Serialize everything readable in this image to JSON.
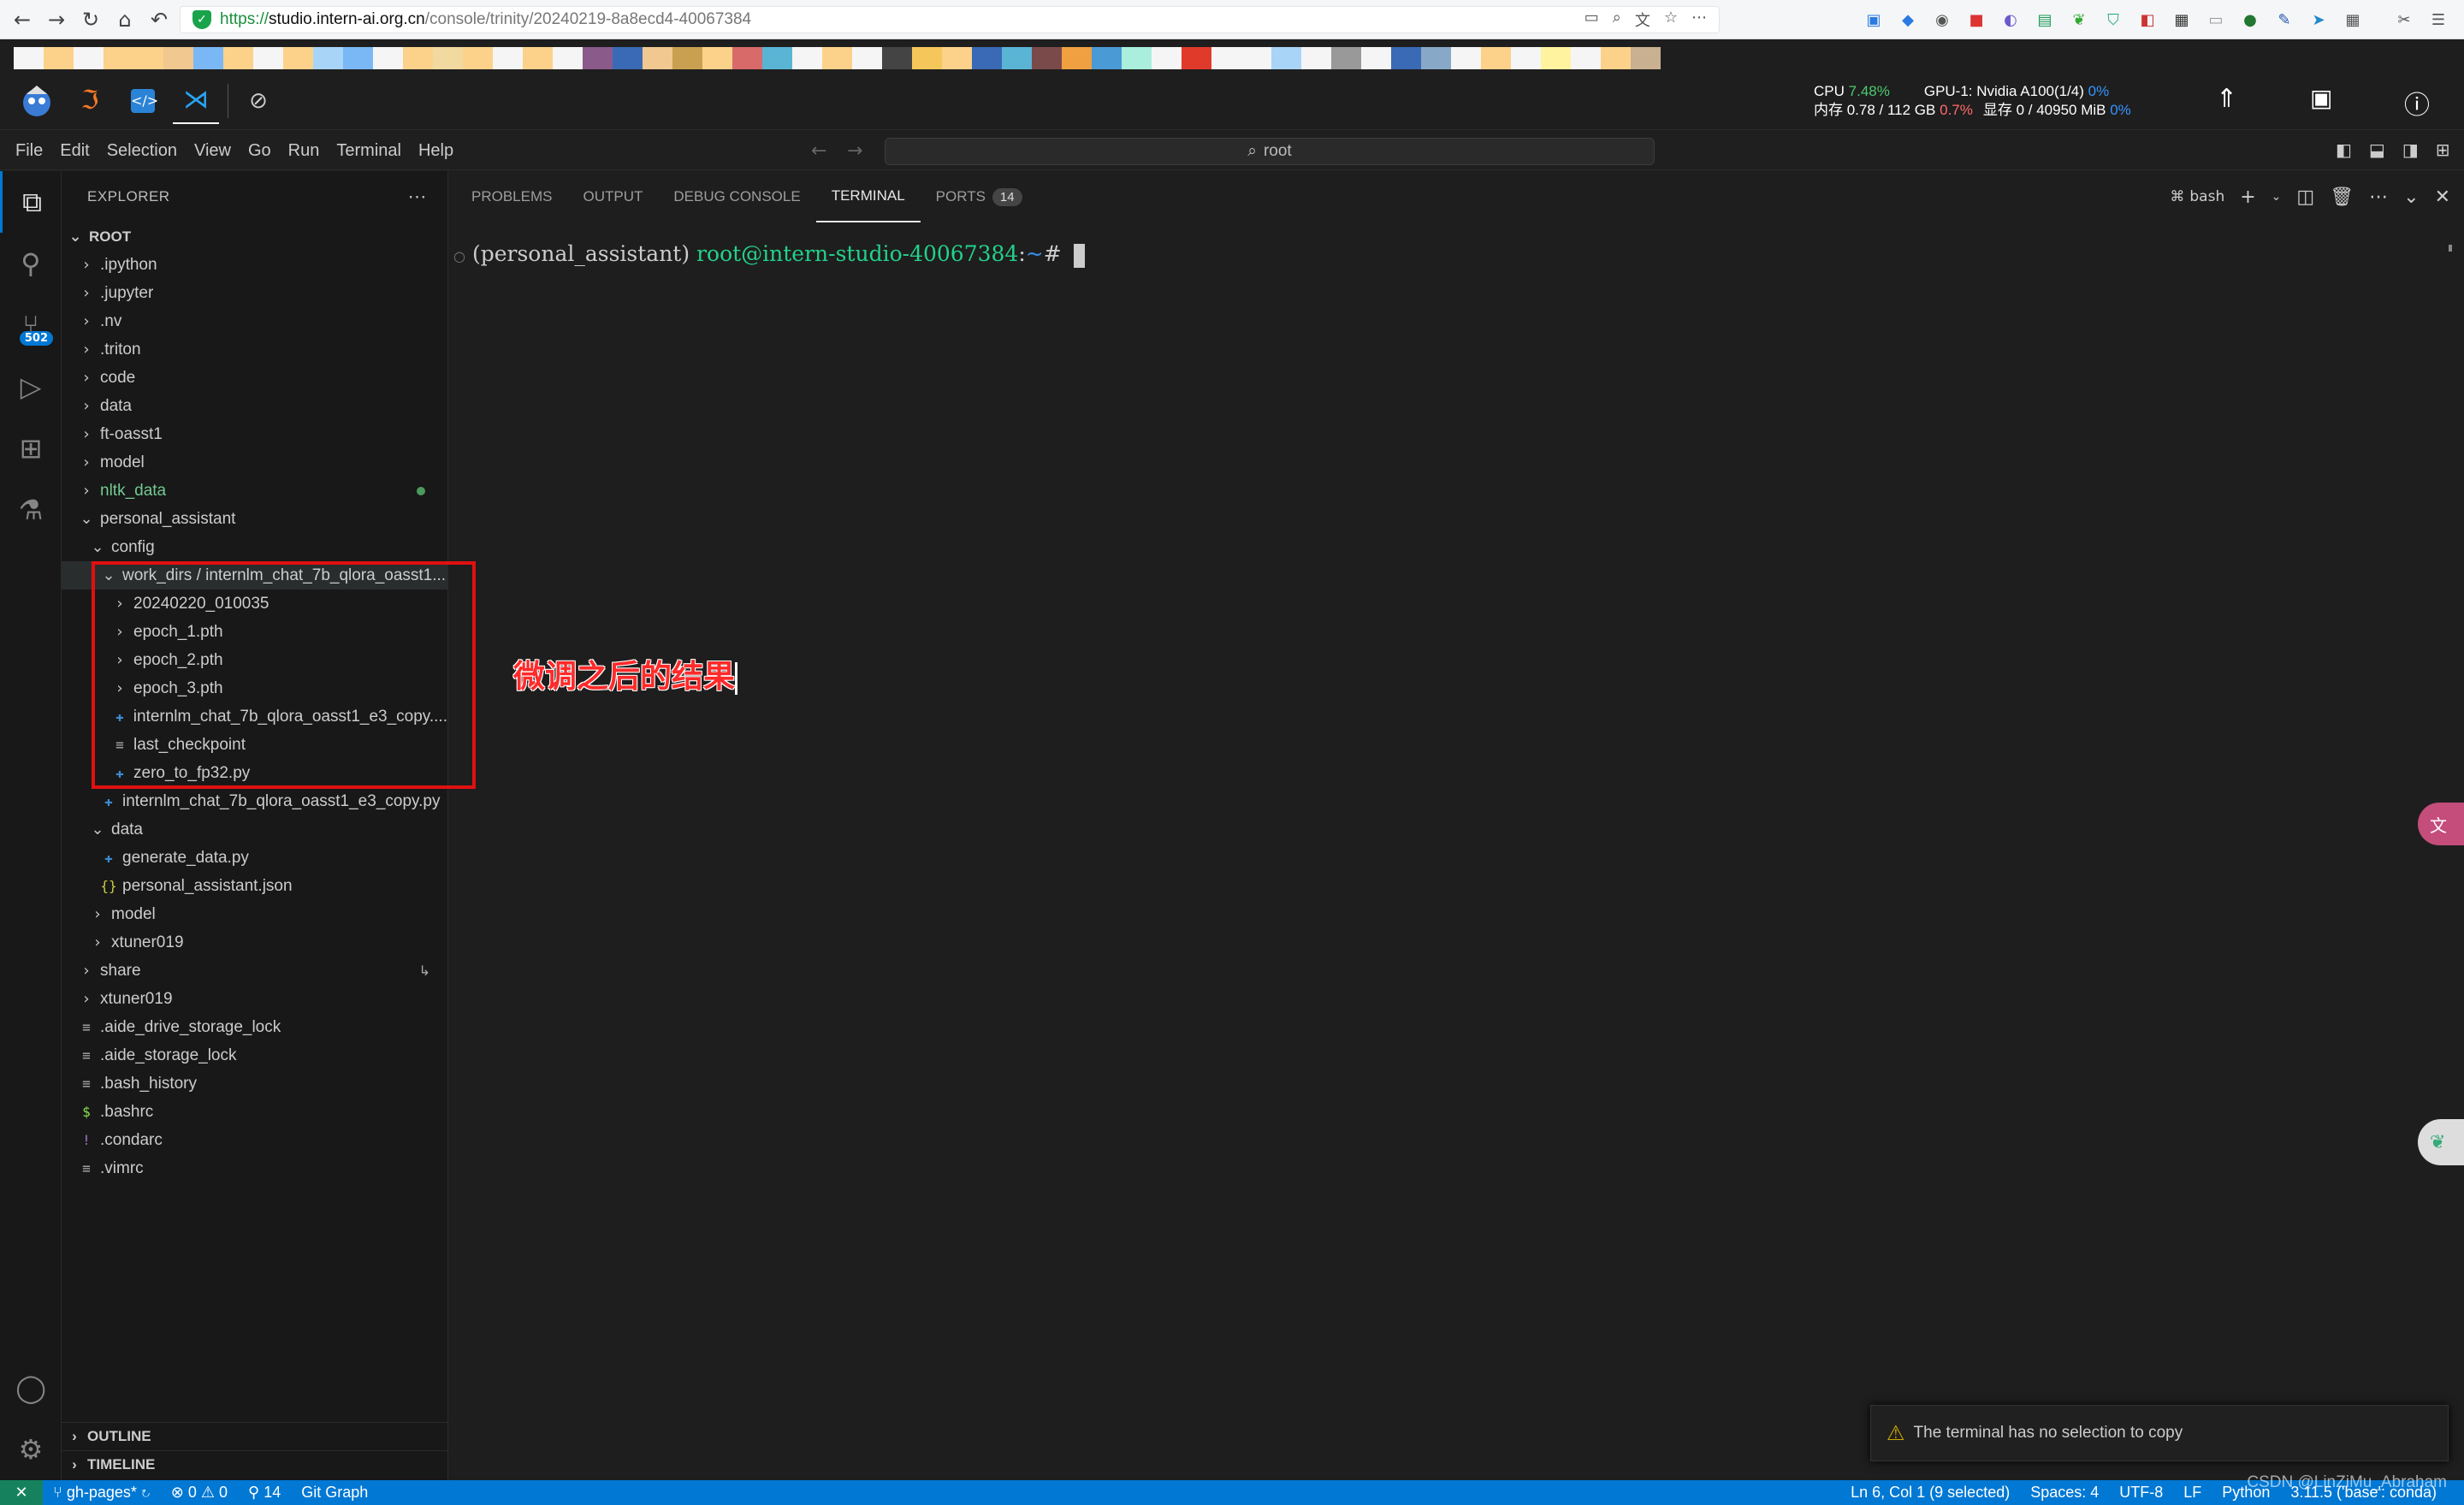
{
  "browser": {
    "url_prefix": "https://",
    "url_host": "studio.intern-ai.org.cn",
    "url_path": "/console/trinity/20240219-8a8ecd4-40067384"
  },
  "bookmark_colors": [
    "#f5f5f5",
    "#fcd28a",
    "#f5f5f5",
    "#fcd28a",
    "#fcd28a",
    "#f0c890",
    "#7ab8f5",
    "#fcd28a",
    "#f5f5f5",
    "#fcd28a",
    "#a8d4f8",
    "#7ab8f5",
    "#f5f5f5",
    "#fcd28a",
    "#f2d9a0",
    "#fcd28a",
    "#f5f5f5",
    "#fcd28a",
    "#f5f5f5",
    "#8a5a8a",
    "#3a6ab5",
    "#f0c890",
    "#c8a050",
    "#fcd28a",
    "#d86a6a",
    "#5ab5d5",
    "#f5f5f5",
    "#fcd28a",
    "#f5f5f5",
    "#444444",
    "#f5c75a",
    "#fcd28a",
    "#3a6ab5",
    "#5ab5d5",
    "#7a4a4a",
    "#f0a040",
    "#4a9ad5",
    "#aaeedd",
    "#f5f5f5",
    "#e03a2a",
    "#f5f5f5",
    "#f5f5f5",
    "#a8d4f8",
    "#f5f5f5",
    "#999999",
    "#f5f5f5",
    "#3a6ab5",
    "#88a8c8",
    "#f5f5f5",
    "#fcd28a",
    "#f5f5f5",
    "#fff3a0",
    "#f5f5f5",
    "#fcd28a",
    "#c8b090"
  ],
  "stats": {
    "cpu_label": "CPU",
    "cpu_value": "7.48%",
    "mem_label": "内存 0.78 / 112 GB",
    "mem_value": "0.7%",
    "gpu_label": "GPU-1: Nvidia A100(1/4)",
    "gpu_value": "0%",
    "vram_label": "显存 0 / 40950 MiB",
    "vram_value": "0%"
  },
  "menu": [
    "File",
    "Edit",
    "Selection",
    "View",
    "Go",
    "Run",
    "Terminal",
    "Help"
  ],
  "command_center": "root",
  "scm_badge": "502",
  "explorer": {
    "title": "EXPLORER",
    "root": "ROOT",
    "items": [
      {
        "label": ".ipython",
        "level": 1,
        "type": "folder",
        "open": false
      },
      {
        "label": ".jupyter",
        "level": 1,
        "type": "folder",
        "open": false
      },
      {
        "label": ".nv",
        "level": 1,
        "type": "folder",
        "open": false
      },
      {
        "label": ".triton",
        "level": 1,
        "type": "folder",
        "open": false
      },
      {
        "label": "code",
        "level": 1,
        "type": "folder",
        "open": false
      },
      {
        "label": "data",
        "level": 1,
        "type": "folder",
        "open": false
      },
      {
        "label": "ft-oasst1",
        "level": 1,
        "type": "folder",
        "open": false
      },
      {
        "label": "model",
        "level": 1,
        "type": "folder",
        "open": false
      },
      {
        "label": "nltk_data",
        "level": 1,
        "type": "folder",
        "open": false,
        "green": true
      },
      {
        "label": "personal_assistant",
        "level": 1,
        "type": "folder",
        "open": true
      },
      {
        "label": "config",
        "level": 2,
        "type": "folder",
        "open": true
      },
      {
        "label": "work_dirs / internlm_chat_7b_qlora_oasst1...",
        "level": 3,
        "type": "folder",
        "open": true,
        "selected": true
      },
      {
        "label": "20240220_010035",
        "level": 4,
        "type": "folder",
        "open": false
      },
      {
        "label": "epoch_1.pth",
        "level": 4,
        "type": "folder",
        "open": false
      },
      {
        "label": "epoch_2.pth",
        "level": 4,
        "type": "folder",
        "open": false
      },
      {
        "label": "epoch_3.pth",
        "level": 4,
        "type": "folder",
        "open": false
      },
      {
        "label": "internlm_chat_7b_qlora_oasst1_e3_copy....",
        "level": 4,
        "type": "python"
      },
      {
        "label": "last_checkpoint",
        "level": 4,
        "type": "text"
      },
      {
        "label": "zero_to_fp32.py",
        "level": 4,
        "type": "python"
      },
      {
        "label": "internlm_chat_7b_qlora_oasst1_e3_copy.py",
        "level": 3,
        "type": "python"
      },
      {
        "label": "data",
        "level": 2,
        "type": "folder",
        "open": true
      },
      {
        "label": "generate_data.py",
        "level": 3,
        "type": "python"
      },
      {
        "label": "personal_assistant.json",
        "level": 3,
        "type": "json"
      },
      {
        "label": "model",
        "level": 2,
        "type": "folder",
        "open": false
      },
      {
        "label": "xtuner019",
        "level": 2,
        "type": "folder",
        "open": false
      },
      {
        "label": "share",
        "level": 1,
        "type": "folder",
        "open": false,
        "link": true
      },
      {
        "label": "xtuner019",
        "level": 1,
        "type": "folder",
        "open": false
      },
      {
        "label": ".aide_drive_storage_lock",
        "level": 1,
        "type": "text"
      },
      {
        "label": ".aide_storage_lock",
        "level": 1,
        "type": "text"
      },
      {
        "label": ".bash_history",
        "level": 1,
        "type": "text"
      },
      {
        "label": ".bashrc",
        "level": 1,
        "type": "shell"
      },
      {
        "label": ".condarc",
        "level": 1,
        "type": "yaml"
      },
      {
        "label": ".vimrc",
        "level": 1,
        "type": "text"
      }
    ],
    "outline": "OUTLINE",
    "timeline": "TIMELINE"
  },
  "panel": {
    "tabs": [
      "PROBLEMS",
      "OUTPUT",
      "DEBUG CONSOLE",
      "TERMINAL",
      "PORTS"
    ],
    "active_tab": "TERMINAL",
    "ports_count": "14",
    "shell": "bash"
  },
  "terminal": {
    "env": "(personal_assistant)",
    "user_host": "root@intern-studio-40067384",
    "colon": ":",
    "path": "~",
    "symbol": "#"
  },
  "annotation": "微调之后的结果",
  "toast": "The terminal has no selection to copy",
  "statusbar": {
    "branch": "gh-pages*",
    "errors": "0",
    "warnings": "0",
    "ports": "14",
    "git_graph": "Git Graph",
    "position": "Ln 6, Col 1 (9 selected)",
    "spaces": "Spaces: 4",
    "encoding": "UTF-8",
    "eol": "LF",
    "language": "Python",
    "interpreter": "3.11.5 ('base': conda)"
  },
  "watermark": "CSDN @LinZiMu_Abraham"
}
